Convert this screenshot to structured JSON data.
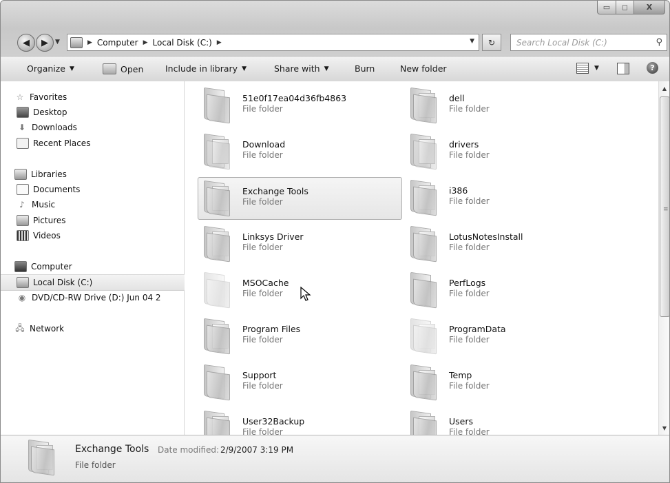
{
  "window": {
    "caption_buttons": [
      {
        "name": "minimize-button",
        "glyph": "▭"
      },
      {
        "name": "maximize-button",
        "glyph": "◻"
      },
      {
        "name": "close-button",
        "glyph": "X"
      }
    ]
  },
  "address_bar": {
    "breadcrumbs": [
      "Computer",
      "Local Disk (C:)"
    ],
    "search_placeholder": "Search Local Disk (C:)"
  },
  "command_bar": {
    "organize": "Organize",
    "open": "Open",
    "include_in_library": "Include in library",
    "share_with": "Share with",
    "burn": "Burn",
    "new_folder": "New folder"
  },
  "nav_pane": {
    "items": [
      {
        "label": "Favorites",
        "icon": "star-icon",
        "indent": 0,
        "group": true
      },
      {
        "label": "Desktop",
        "icon": "desktop-icon",
        "indent": 1
      },
      {
        "label": "Downloads",
        "icon": "downloads-icon",
        "indent": 1
      },
      {
        "label": "Recent Places",
        "icon": "recent-places-icon",
        "indent": 1
      },
      {
        "label": "Libraries",
        "icon": "libraries-icon",
        "indent": 0,
        "group": true
      },
      {
        "label": "Documents",
        "icon": "documents-icon",
        "indent": 1
      },
      {
        "label": "Music",
        "icon": "music-icon",
        "indent": 1
      },
      {
        "label": "Pictures",
        "icon": "pictures-icon",
        "indent": 1
      },
      {
        "label": "Videos",
        "icon": "videos-icon",
        "indent": 1
      },
      {
        "label": "Computer",
        "icon": "computer-icon",
        "indent": 0,
        "group": true
      },
      {
        "label": "Local Disk (C:)",
        "icon": "local-disk-icon",
        "indent": 1,
        "selected": true
      },
      {
        "label": "DVD/CD-RW Drive (D:) Jun 04 2",
        "icon": "dvd-drive-icon",
        "indent": 1
      },
      {
        "label": "Network",
        "icon": "network-icon",
        "indent": 0,
        "group": true
      }
    ]
  },
  "folders": [
    {
      "name": "51e0f17ea04d36fb4863",
      "type": "File folder"
    },
    {
      "name": "dell",
      "type": "File folder"
    },
    {
      "name": "Download",
      "type": "File folder"
    },
    {
      "name": "drivers",
      "type": "File folder"
    },
    {
      "name": "Exchange Tools",
      "type": "File folder",
      "selected": true
    },
    {
      "name": "i386",
      "type": "File folder"
    },
    {
      "name": "Linksys Driver",
      "type": "File folder"
    },
    {
      "name": "LotusNotesInstall",
      "type": "File folder"
    },
    {
      "name": "MSOCache",
      "type": "File folder",
      "faded": true
    },
    {
      "name": "PerfLogs",
      "type": "File folder"
    },
    {
      "name": "Program Files",
      "type": "File folder"
    },
    {
      "name": "ProgramData",
      "type": "File folder",
      "faded": true
    },
    {
      "name": "Support",
      "type": "File folder"
    },
    {
      "name": "Temp",
      "type": "File folder"
    },
    {
      "name": "User32Backup",
      "type": "File folder"
    },
    {
      "name": "Users",
      "type": "File folder"
    }
  ],
  "details": {
    "name": "Exchange Tools",
    "date_label": "Date modified:",
    "date_value": "2/9/2007 3:19 PM",
    "type": "File folder"
  }
}
